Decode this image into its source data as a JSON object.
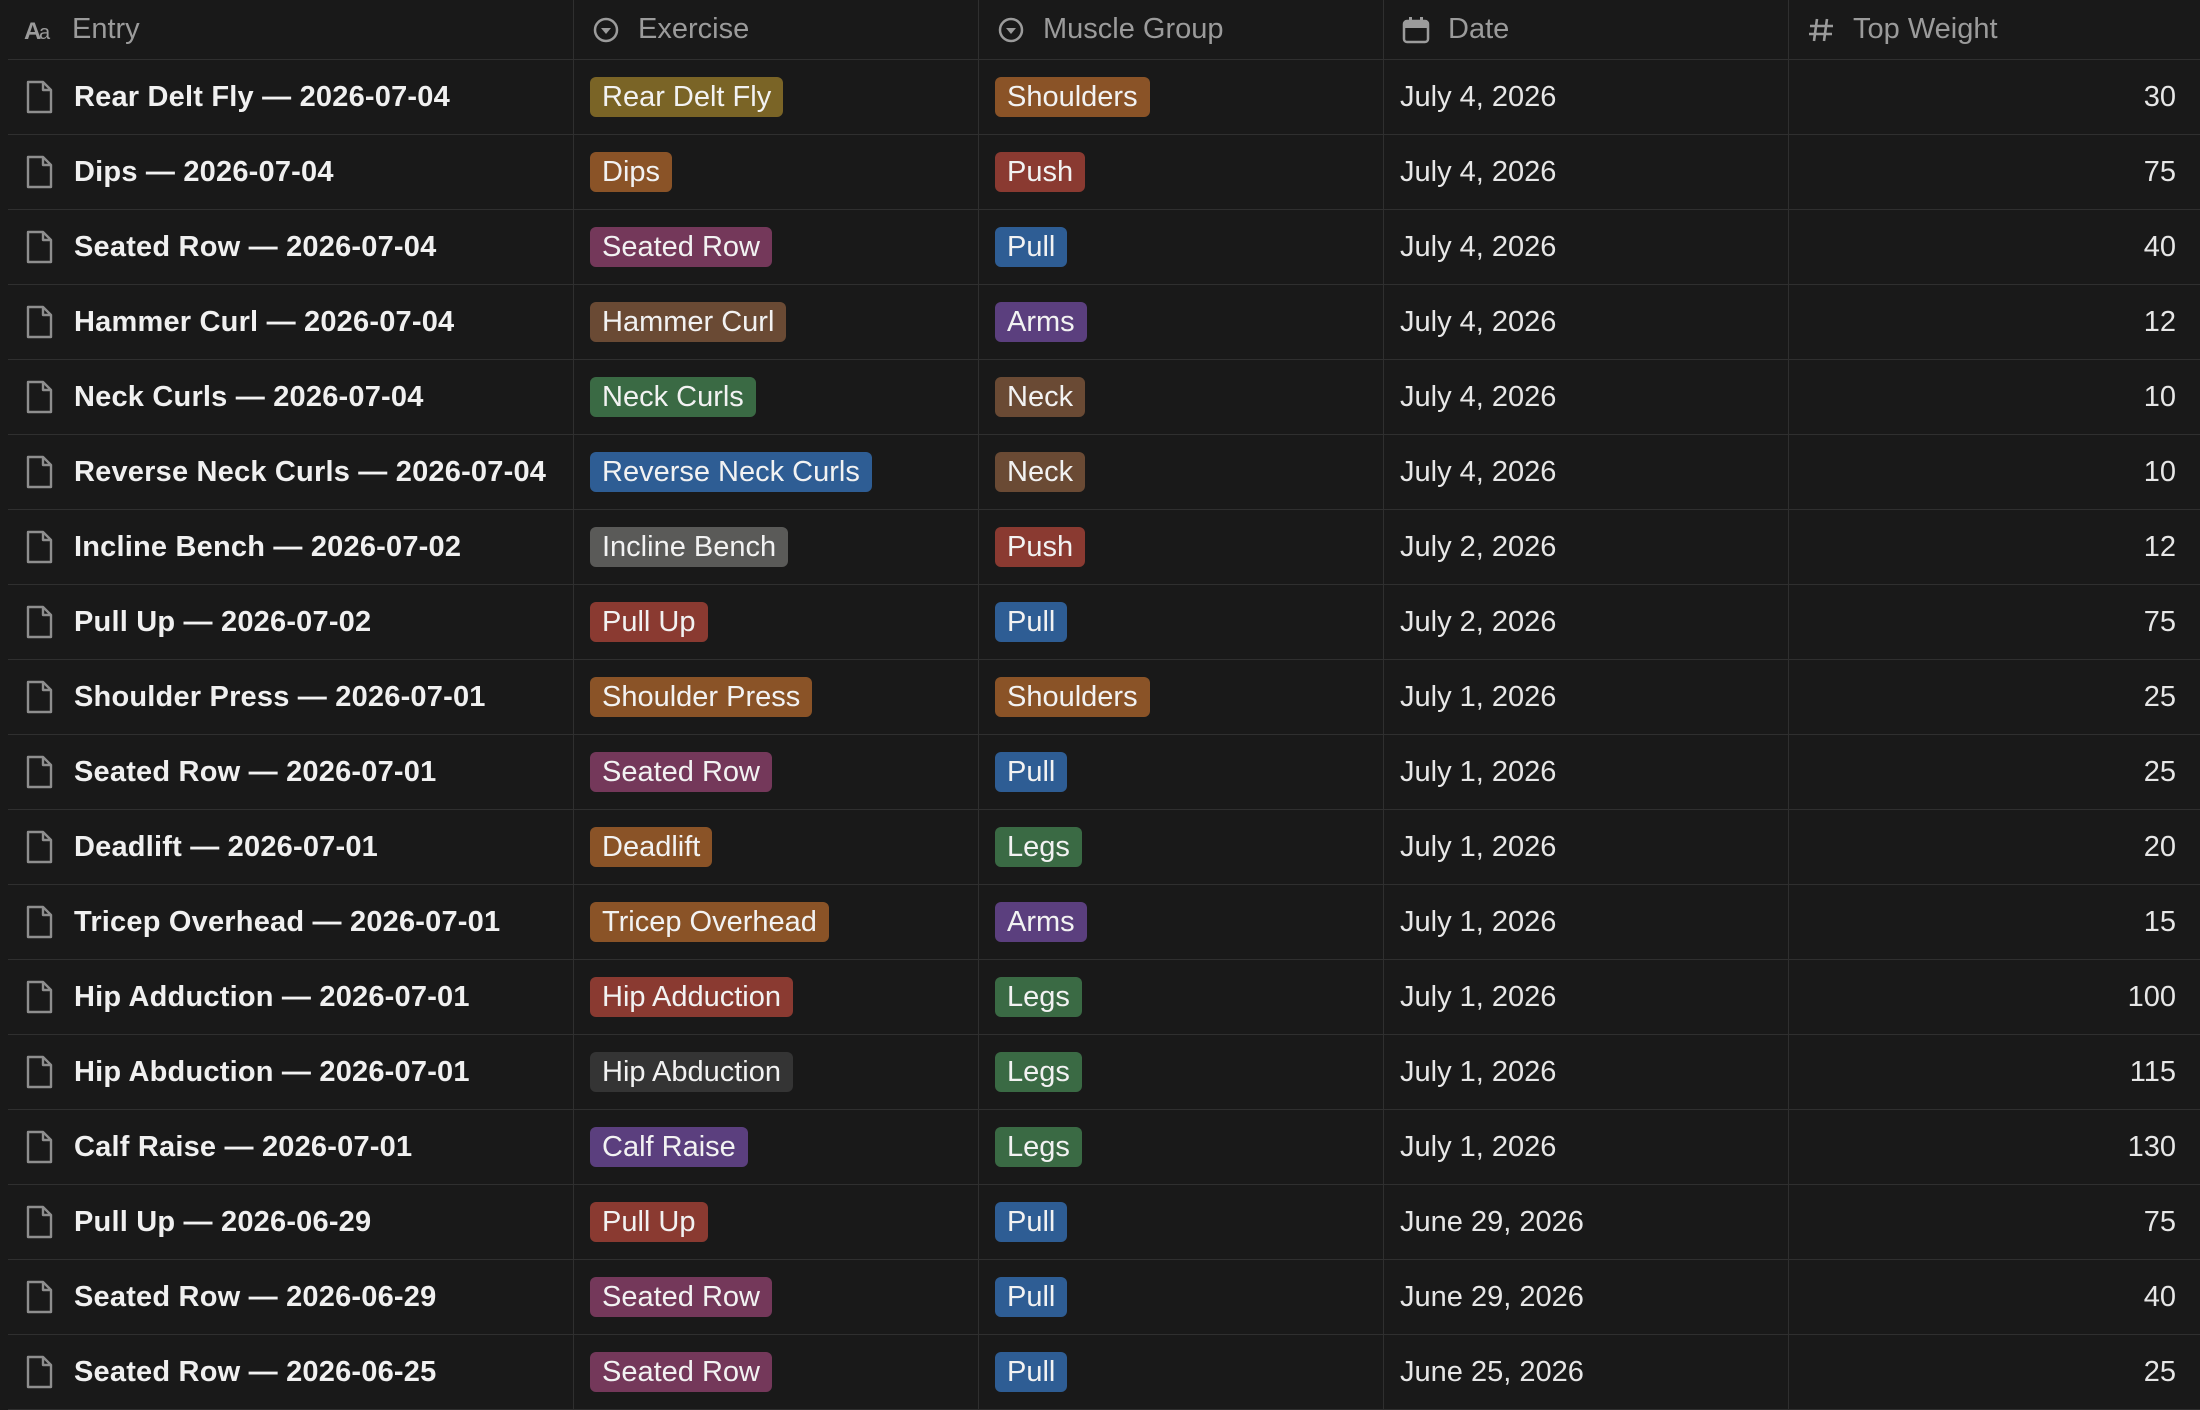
{
  "columns": {
    "entry": "Entry",
    "exercise": "Exercise",
    "muscle_group": "Muscle Group",
    "date": "Date",
    "top_weight": "Top Weight"
  },
  "icons": {
    "entry": "title-aa-icon",
    "exercise": "select-icon",
    "muscle_group": "select-icon",
    "date": "calendar-icon",
    "top_weight": "number-hash-icon",
    "row": "page-icon"
  },
  "tag_colors": {
    "yellow": "#7a6426",
    "orange": "#8a5327",
    "brown": "#6a4a34",
    "red": "#8a3a31",
    "pink": "#74385a",
    "blue": "#2e5d94",
    "purple": "#5b3f7e",
    "green": "#3a6a44",
    "gray": "#5a5a58",
    "default": "#343434"
  },
  "rows": [
    {
      "entry": "Rear Delt Fly — 2026-07-04",
      "exercise": "Rear Delt Fly",
      "exercise_color": "yellow",
      "muscle": "Shoulders",
      "muscle_color": "orange",
      "date": "July 4, 2026",
      "weight": "30"
    },
    {
      "entry": "Dips — 2026-07-04",
      "exercise": "Dips",
      "exercise_color": "orange",
      "muscle": "Push",
      "muscle_color": "red",
      "date": "July 4, 2026",
      "weight": "75"
    },
    {
      "entry": "Seated Row — 2026-07-04",
      "exercise": "Seated Row",
      "exercise_color": "pink",
      "muscle": "Pull",
      "muscle_color": "blue",
      "date": "July 4, 2026",
      "weight": "40"
    },
    {
      "entry": "Hammer Curl — 2026-07-04",
      "exercise": "Hammer Curl",
      "exercise_color": "brown",
      "muscle": "Arms",
      "muscle_color": "purple",
      "date": "July 4, 2026",
      "weight": "12"
    },
    {
      "entry": "Neck Curls — 2026-07-04",
      "exercise": "Neck Curls",
      "exercise_color": "green",
      "muscle": "Neck",
      "muscle_color": "brown",
      "date": "July 4, 2026",
      "weight": "10"
    },
    {
      "entry": "Reverse Neck Curls — 2026-07-04",
      "exercise": "Reverse Neck Curls",
      "exercise_color": "blue",
      "muscle": "Neck",
      "muscle_color": "brown",
      "date": "July 4, 2026",
      "weight": "10"
    },
    {
      "entry": "Incline Bench — 2026-07-02",
      "exercise": "Incline Bench",
      "exercise_color": "gray",
      "muscle": "Push",
      "muscle_color": "red",
      "date": "July 2, 2026",
      "weight": "12"
    },
    {
      "entry": "Pull Up — 2026-07-02",
      "exercise": "Pull Up",
      "exercise_color": "red",
      "muscle": "Pull",
      "muscle_color": "blue",
      "date": "July 2, 2026",
      "weight": "75"
    },
    {
      "entry": "Shoulder Press — 2026-07-01",
      "exercise": "Shoulder Press",
      "exercise_color": "orange",
      "muscle": "Shoulders",
      "muscle_color": "orange",
      "date": "July 1, 2026",
      "weight": "25"
    },
    {
      "entry": "Seated Row — 2026-07-01",
      "exercise": "Seated Row",
      "exercise_color": "pink",
      "muscle": "Pull",
      "muscle_color": "blue",
      "date": "July 1, 2026",
      "weight": "25"
    },
    {
      "entry": "Deadlift — 2026-07-01",
      "exercise": "Deadlift",
      "exercise_color": "orange",
      "muscle": "Legs",
      "muscle_color": "green",
      "date": "July 1, 2026",
      "weight": "20"
    },
    {
      "entry": "Tricep Overhead — 2026-07-01",
      "exercise": "Tricep Overhead",
      "exercise_color": "orange",
      "muscle": "Arms",
      "muscle_color": "purple",
      "date": "July 1, 2026",
      "weight": "15"
    },
    {
      "entry": "Hip Adduction — 2026-07-01",
      "exercise": "Hip Adduction",
      "exercise_color": "red",
      "muscle": "Legs",
      "muscle_color": "green",
      "date": "July 1, 2026",
      "weight": "100"
    },
    {
      "entry": "Hip Abduction — 2026-07-01",
      "exercise": "Hip Abduction",
      "exercise_color": "default",
      "muscle": "Legs",
      "muscle_color": "green",
      "date": "July 1, 2026",
      "weight": "115"
    },
    {
      "entry": "Calf Raise — 2026-07-01",
      "exercise": "Calf Raise",
      "exercise_color": "purple",
      "muscle": "Legs",
      "muscle_color": "green",
      "date": "July 1, 2026",
      "weight": "130"
    },
    {
      "entry": "Pull Up — 2026-06-29",
      "exercise": "Pull Up",
      "exercise_color": "red",
      "muscle": "Pull",
      "muscle_color": "blue",
      "date": "June 29, 2026",
      "weight": "75"
    },
    {
      "entry": "Seated Row — 2026-06-29",
      "exercise": "Seated Row",
      "exercise_color": "pink",
      "muscle": "Pull",
      "muscle_color": "blue",
      "date": "June 29, 2026",
      "weight": "40"
    },
    {
      "entry": "Seated Row — 2026-06-25",
      "exercise": "Seated Row",
      "exercise_color": "pink",
      "muscle": "Pull",
      "muscle_color": "blue",
      "date": "June 25, 2026",
      "weight": "25"
    }
  ]
}
